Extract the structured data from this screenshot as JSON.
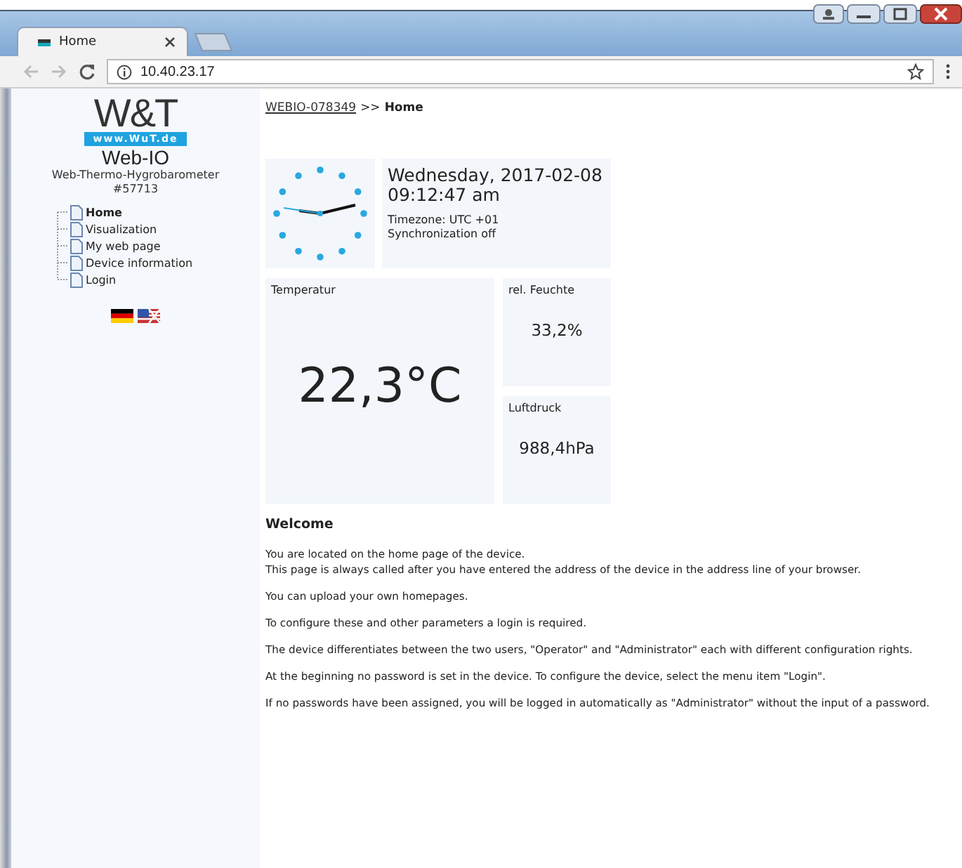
{
  "browser": {
    "tab_title": "Home",
    "address": "10.40.23.17"
  },
  "sidebar": {
    "logo": "W&T",
    "logo_url": "www.WuT.de",
    "product": "Web-IO",
    "device": "Web-Thermo-Hygrobarometer",
    "number": "#57713",
    "menu": [
      {
        "label": "Home",
        "selected": true
      },
      {
        "label": "Visualization",
        "selected": false
      },
      {
        "label": "My web page",
        "selected": false
      },
      {
        "label": "Device information",
        "selected": false
      },
      {
        "label": "Login",
        "selected": false
      }
    ]
  },
  "breadcrumb": {
    "link": "WEBIO-078349",
    "separator": ">>",
    "current": "Home"
  },
  "clock": {
    "date": "Wednesday, 2017-02-08",
    "time": "09:12:47 am",
    "timezone": "Timezone: UTC +01",
    "sync": "Synchronization off"
  },
  "sensors": [
    {
      "label": "Temperatur",
      "value": "22,3°C"
    },
    {
      "label": "rel. Feuchte",
      "value": "33,2%"
    },
    {
      "label": "Luftdruck",
      "value": "988,4hPa"
    }
  ],
  "welcome": {
    "title": "Welcome",
    "paragraphs": [
      "You are located on the home page of the device.\nThis page is always called after you have entered the address of the device in the address line of your browser.",
      "You can upload your own homepages.",
      "To configure these and other parameters a login is required.",
      "The device differentiates between the two users, \"Operator\" and \"Administrator\" each with different configuration rights.",
      "At the beginning no password is set in the device. To configure the device, select the menu item \"Login\".",
      "If no passwords have been assigned, you will be logged in automatically as \"Administrator\" without the input of a password."
    ]
  }
}
